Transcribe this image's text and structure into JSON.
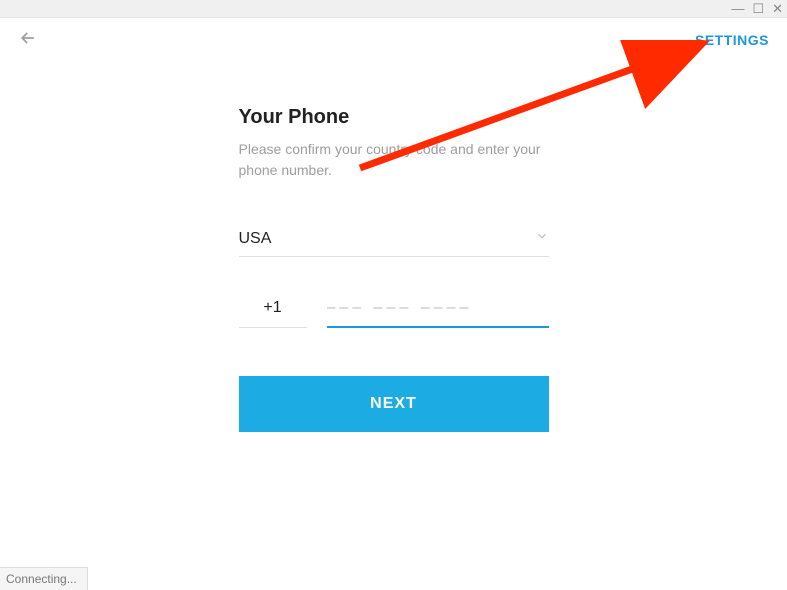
{
  "window": {
    "minimize": "—",
    "maximize": "☐",
    "close": "✕"
  },
  "header": {
    "settings_label": "SETTINGS"
  },
  "form": {
    "title": "Your Phone",
    "subtitle": "Please confirm your country code and enter your phone number.",
    "country": "USA",
    "code": "+1",
    "phone_value": "",
    "phone_placeholder": "––– ––– ––––",
    "next_label": "NEXT"
  },
  "status": {
    "connecting": "Connecting..."
  },
  "colors": {
    "accent": "#1d98dc",
    "button": "#1dabe3"
  }
}
